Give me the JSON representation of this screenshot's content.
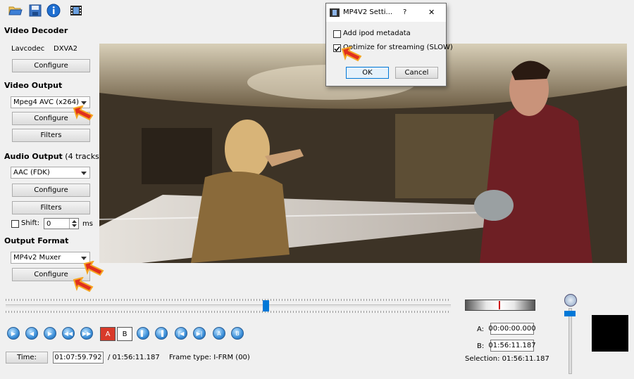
{
  "toolbar": {
    "icons": [
      "open-folder-icon",
      "save-icon",
      "info-icon",
      "film-icon"
    ]
  },
  "video_decoder": {
    "title": "Video Decoder",
    "decoder_label": "Lavcodec",
    "decoder_value": "DXVA2",
    "configure_label": "Configure"
  },
  "video_output": {
    "title": "Video Output",
    "codec_value": "Mpeg4 AVC (x264)",
    "configure_label": "Configure",
    "filters_label": "Filters"
  },
  "audio_output": {
    "title": "Audio Output",
    "tracks": "(4 tracks)",
    "codec_value": "AAC (FDK)",
    "configure_label": "Configure",
    "filters_label": "Filters",
    "shift_label": "Shift:",
    "shift_value": "0",
    "shift_unit": "ms",
    "shift_checked": false
  },
  "output_format": {
    "title": "Output Format",
    "muxer_value": "MP4v2 Muxer",
    "configure_label": "Configure"
  },
  "dialog": {
    "title": "MP4V2 Setti...",
    "help": "?",
    "close": "✕",
    "option1_label": "Add ipod metadata",
    "option1_checked": false,
    "option2_label": "Optimize for streaming (SLOW)",
    "option2_checked": true,
    "ok_label": "OK",
    "cancel_label": "Cancel"
  },
  "playback": {
    "slider_position": 0.6,
    "ab_markers": [
      "A",
      "B"
    ],
    "time_button_label": "Time:",
    "current_time": "01:07:59.792",
    "total_time": "/ 01:56:11.187",
    "frame_type": "Frame type:  I-FRM (00)"
  },
  "selection": {
    "a_label": "A:",
    "a_value": "00:00:00.000",
    "b_label": "B:",
    "b_value": "01:56:11.187",
    "selection_text": "Selection: 01:56:11.187"
  },
  "colors": {
    "accent": "#0078d7",
    "pointer_red": "#e0301e",
    "pointer_orange": "#f5a623"
  }
}
